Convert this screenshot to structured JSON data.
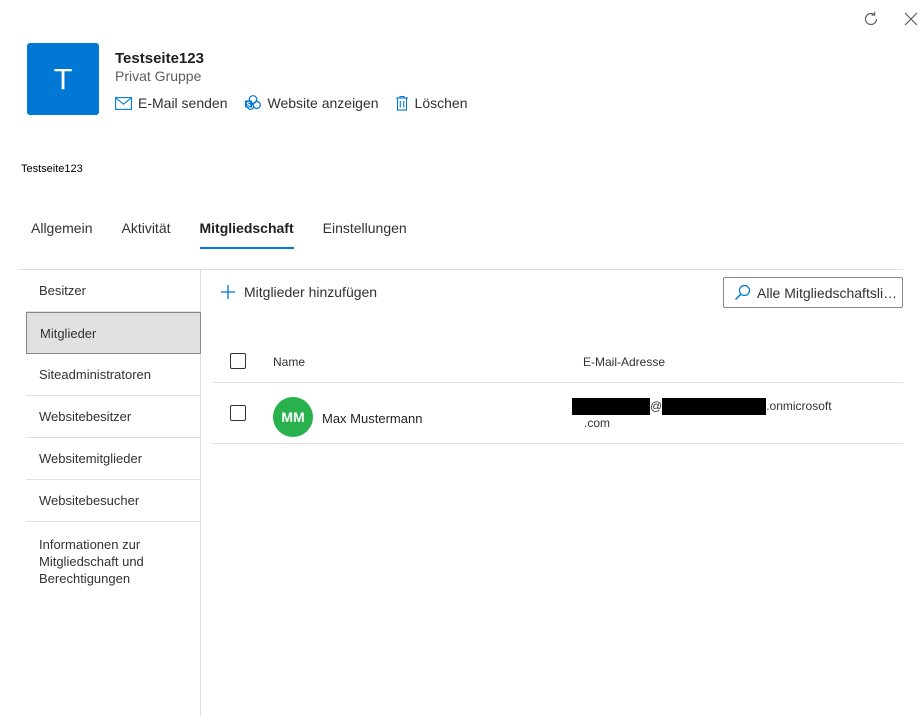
{
  "window": {
    "refresh_icon": "refresh-icon",
    "close_icon": "close-icon"
  },
  "group": {
    "avatar_letter": "T",
    "title": "Testseite123",
    "subtitle": "Privat Gruppe",
    "actions": [
      {
        "icon": "mail-icon",
        "label": "E-Mail senden"
      },
      {
        "icon": "sharepoint-icon",
        "label": "Website anzeigen"
      },
      {
        "icon": "trash-icon",
        "label": "Löschen"
      }
    ]
  },
  "breadcrumb": "Testseite123",
  "tabs": [
    {
      "label": "Allgemein",
      "active": false
    },
    {
      "label": "Aktivität",
      "active": false
    },
    {
      "label": "Mitgliedschaft",
      "active": true
    },
    {
      "label": "Einstellungen",
      "active": false
    }
  ],
  "nav": {
    "items": [
      {
        "label": "Besitzer",
        "selected": false
      },
      {
        "label": "Mitglieder",
        "selected": true
      },
      {
        "label": "Siteadministratoren",
        "selected": false
      },
      {
        "label": "Websitebesitzer",
        "selected": false
      },
      {
        "label": "Websitemitglieder",
        "selected": false
      },
      {
        "label": "Websitebesucher",
        "selected": false
      },
      {
        "label": "Informationen zur Mitgliedschaft und Berechtigungen",
        "selected": false
      }
    ]
  },
  "toolbar": {
    "add_label": "Mitglieder hinzufügen",
    "search_placeholder": "Alle Mitgliedschaftslis..."
  },
  "table": {
    "columns": [
      "Name",
      "E-Mail-Adresse"
    ],
    "rows": [
      {
        "initials": "MM",
        "name": "Max Mustermann",
        "email_at": "@",
        "email_domain_tail": ".onmicrosoft",
        "email_tld": ".com"
      }
    ]
  },
  "colors": {
    "accent": "#0078d4",
    "persona": "#28b14c"
  }
}
